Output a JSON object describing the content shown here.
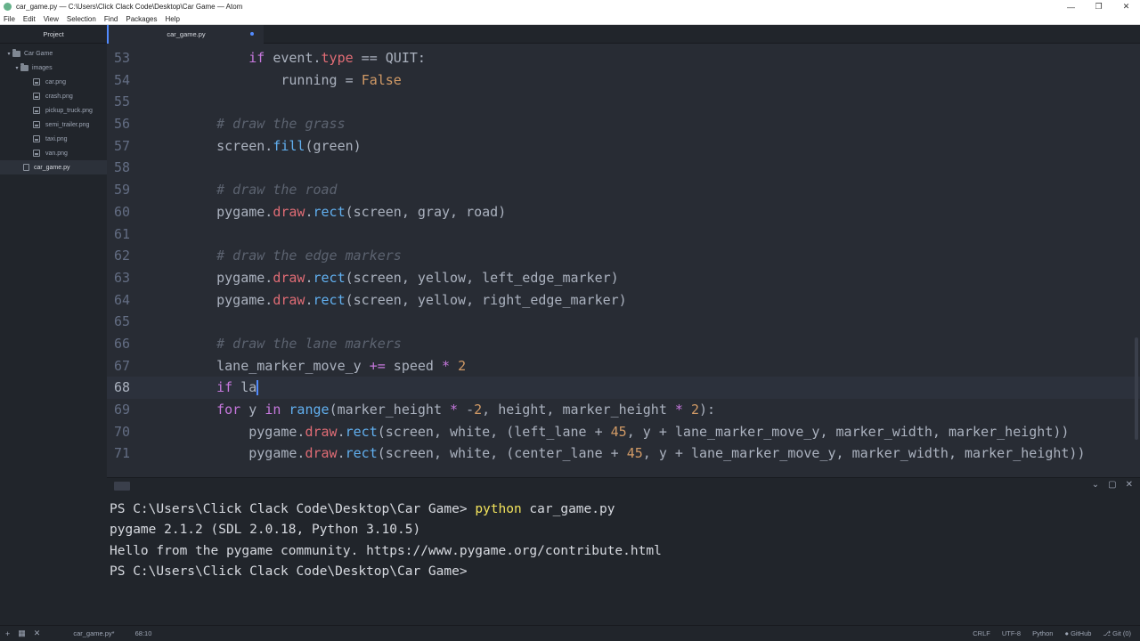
{
  "window": {
    "title": "car_game.py — C:\\Users\\Click Clack Code\\Desktop\\Car Game — Atom"
  },
  "menu": [
    "File",
    "Edit",
    "View",
    "Selection",
    "Find",
    "Packages",
    "Help"
  ],
  "tree": {
    "header": "Project",
    "root": "Car Game",
    "folder": "images",
    "images": [
      "car.png",
      "crash.png",
      "pickup_truck.png",
      "semi_trailer.png",
      "taxi.png",
      "van.png"
    ],
    "file": "car_game.py"
  },
  "tab": {
    "label": "car_game.py"
  },
  "editor": {
    "line_numbers": [
      "53",
      "54",
      "55",
      "56",
      "57",
      "58",
      "59",
      "60",
      "61",
      "62",
      "63",
      "64",
      "65",
      "66",
      "67",
      "68",
      "69",
      "70",
      "71"
    ],
    "current_line": "68"
  },
  "terminal": {
    "lines": [
      "PS C:\\Users\\Click Clack Code\\Desktop\\Car Game>",
      "pygame 2.1.2 (SDL 2.0.18, Python 3.10.5)",
      "Hello from the pygame community. https://www.pygame.org/contribute.html",
      "PS C:\\Users\\Click Clack Code\\Desktop\\Car Game>"
    ],
    "command_keyword": "python",
    "command_arg": " car_game.py"
  },
  "status": {
    "file": "car_game.py*",
    "position": "68:10",
    "line_ending": "CRLF",
    "encoding": "UTF-8",
    "grammar": "Python",
    "github": "GitHub",
    "git": "Git (0)"
  },
  "colors": {
    "accent": "#528bff",
    "keyword": "#c678dd",
    "function": "#61afef",
    "member": "#e06c75",
    "number": "#d19a66",
    "comment": "#5c6370"
  }
}
